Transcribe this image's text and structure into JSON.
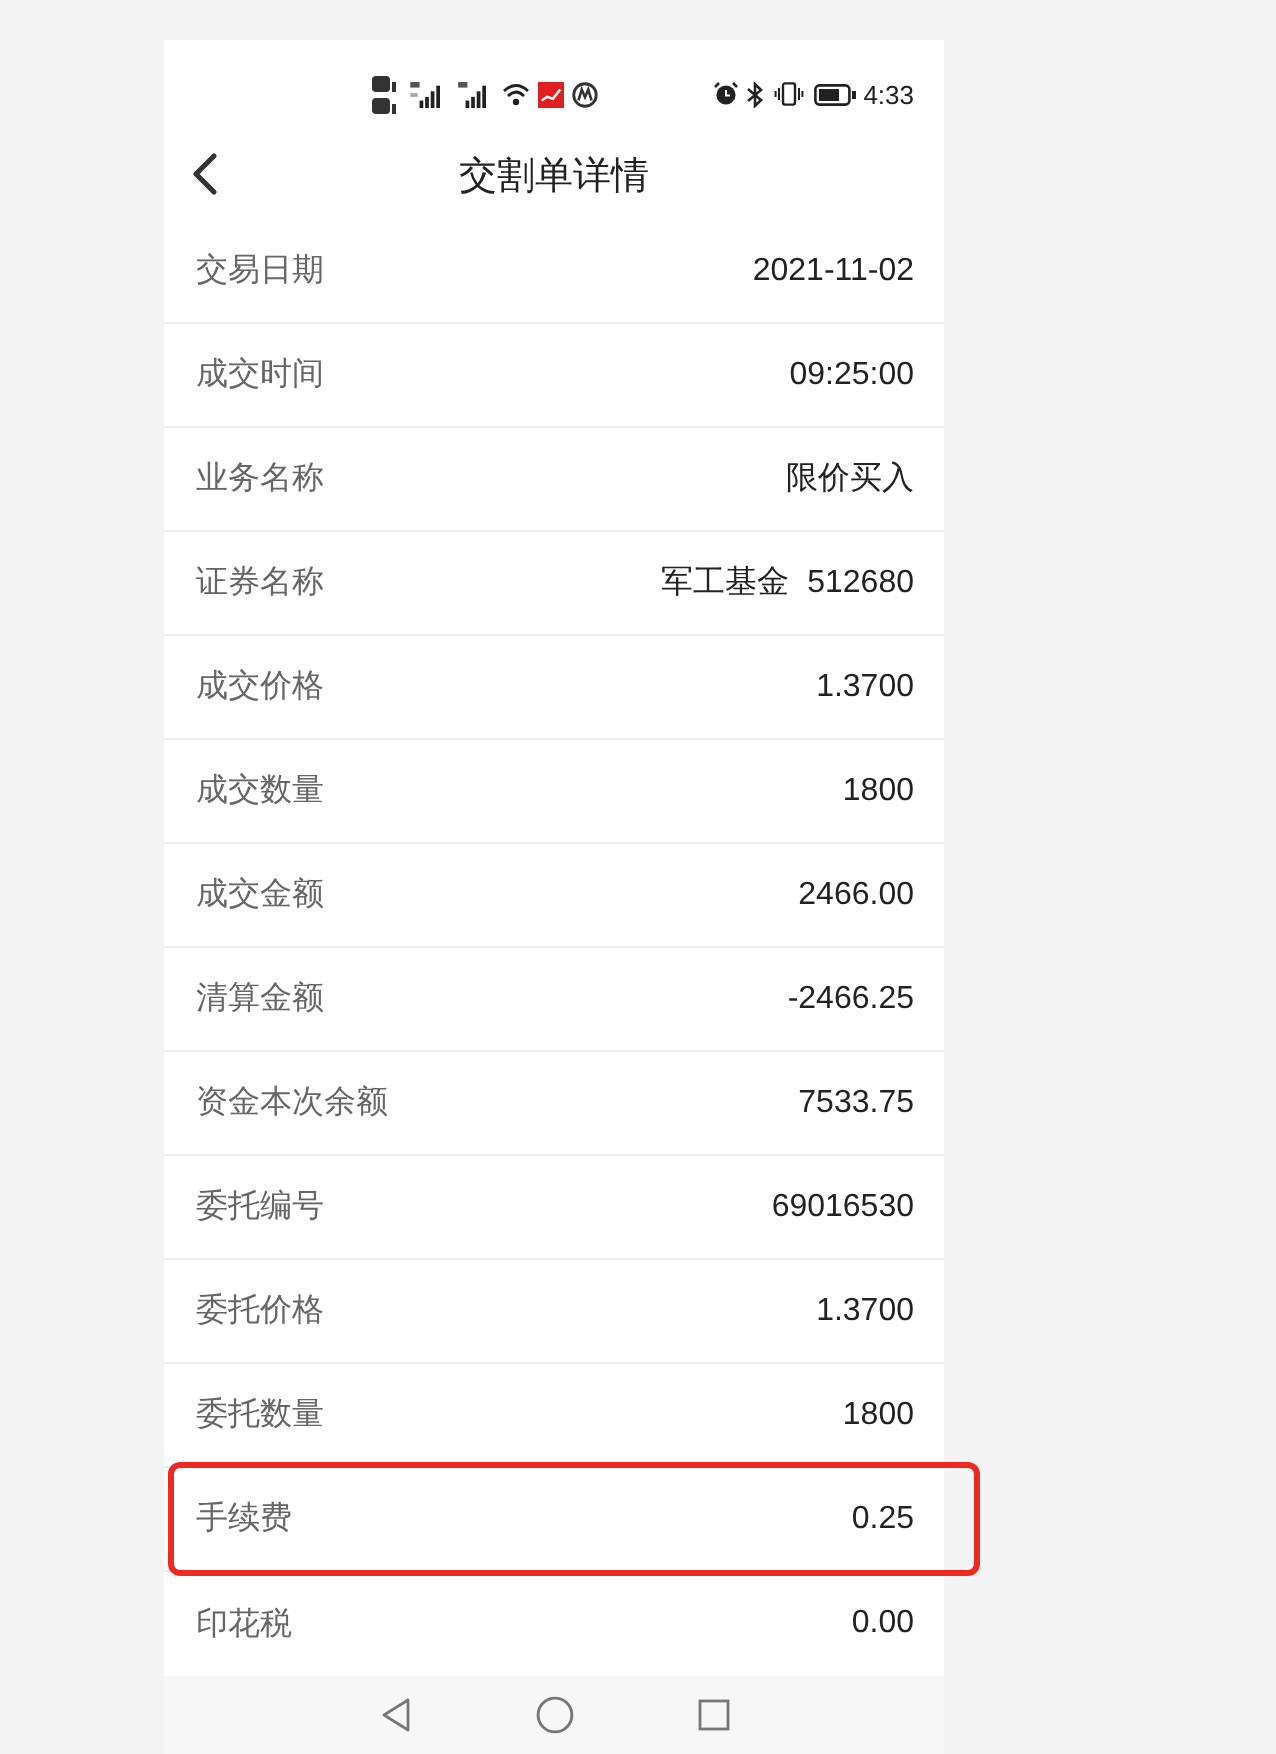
{
  "status_bar": {
    "time": "4:33"
  },
  "header": {
    "title": "交割单详情"
  },
  "rows": [
    {
      "label": "交易日期",
      "value": "2021-11-02",
      "highlighted": false
    },
    {
      "label": "成交时间",
      "value": "09:25:00",
      "highlighted": false
    },
    {
      "label": "业务名称",
      "value": "限价买入",
      "highlighted": false
    },
    {
      "label": "证券名称",
      "value": "军工基金  512680",
      "highlighted": false
    },
    {
      "label": "成交价格",
      "value": "1.3700",
      "highlighted": false
    },
    {
      "label": "成交数量",
      "value": "1800",
      "highlighted": false
    },
    {
      "label": "成交金额",
      "value": "2466.00",
      "highlighted": false
    },
    {
      "label": "清算金额",
      "value": "-2466.25",
      "highlighted": false
    },
    {
      "label": "资金本次余额",
      "value": "7533.75",
      "highlighted": false
    },
    {
      "label": "委托编号",
      "value": "69016530",
      "highlighted": false
    },
    {
      "label": "委托价格",
      "value": "1.3700",
      "highlighted": false
    },
    {
      "label": "委托数量",
      "value": "1800",
      "highlighted": false
    },
    {
      "label": "手续费",
      "value": "0.25",
      "highlighted": true
    },
    {
      "label": "印花税",
      "value": "0.00",
      "highlighted": false
    }
  ]
}
